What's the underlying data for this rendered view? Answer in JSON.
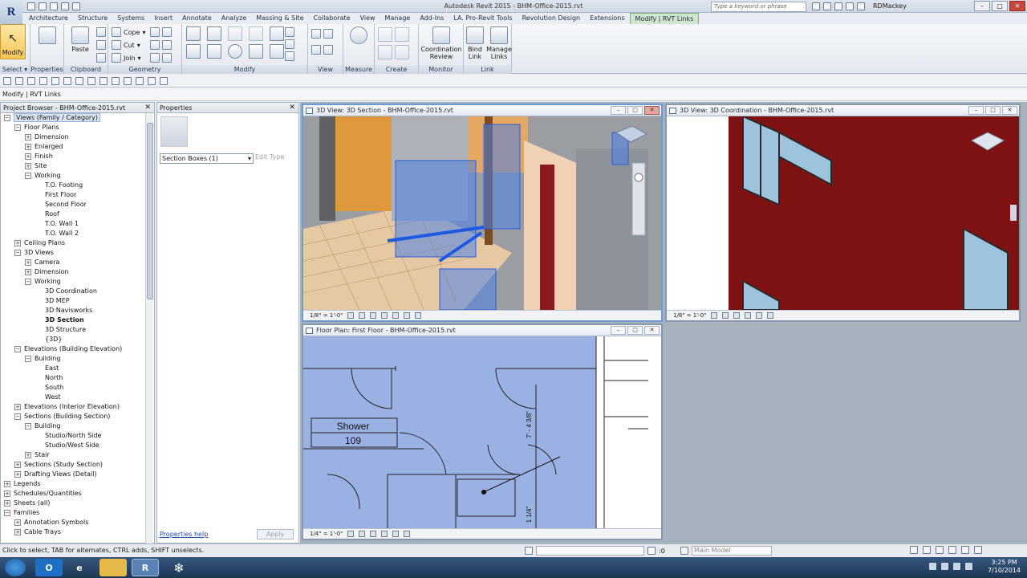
{
  "app": {
    "title": "Autodesk Revit 2015 -    BHM-Office-2015.rvt",
    "search_placeholder": "Type a keyword or phrase",
    "user": "RDMackey"
  },
  "tabs": [
    "Architecture",
    "Structure",
    "Systems",
    "Insert",
    "Annotate",
    "Analyze",
    "Massing & Site",
    "Collaborate",
    "View",
    "Manage",
    "Add-Ins",
    "LA. Pro-Revit Tools",
    "Revolution Design",
    "Extensions",
    "Modify | RVT Links"
  ],
  "ribbon": {
    "modify_label": "Modify",
    "select_label": "Select",
    "properties_label": "Properties",
    "clipboard": {
      "paste": "Paste",
      "label": "Clipboard"
    },
    "geometry": {
      "cope": "Cope",
      "cut": "Cut",
      "join": "Join",
      "label": "Geometry"
    },
    "modify_panel_label": "Modify",
    "view_label": "View",
    "measure_label": "Measure",
    "create_label": "Create",
    "coordination_review": "Coordination Review",
    "monitor_label": "Monitor",
    "bind_link": "Bind Link",
    "manage_links": "Manage Links",
    "link_label": "Link"
  },
  "option_bar": "Modify | RVT Links",
  "project_browser": {
    "title": "Project Browser - BHM-Office-2015.rvt",
    "items": [
      {
        "label": "Views (Family / Category)",
        "level": 0,
        "exp": "−",
        "hl": true
      },
      {
        "label": "Floor Plans",
        "level": 1,
        "exp": "−"
      },
      {
        "label": "Dimension",
        "level": 2,
        "exp": "+"
      },
      {
        "label": "Enlarged",
        "level": 2,
        "exp": "+"
      },
      {
        "label": "Finish",
        "level": 2,
        "exp": "+"
      },
      {
        "label": "Site",
        "level": 2,
        "exp": "+"
      },
      {
        "label": "Working",
        "level": 2,
        "exp": "−"
      },
      {
        "label": "T.O. Footing",
        "level": 3
      },
      {
        "label": "First Floor",
        "level": 3
      },
      {
        "label": "Second Floor",
        "level": 3
      },
      {
        "label": "Roof",
        "level": 3
      },
      {
        "label": "T.O. Wall 1",
        "level": 3
      },
      {
        "label": "T.O. Wall 2",
        "level": 3
      },
      {
        "label": "Ceiling Plans",
        "level": 1,
        "exp": "+"
      },
      {
        "label": "3D Views",
        "level": 1,
        "exp": "−"
      },
      {
        "label": "Camera",
        "level": 2,
        "exp": "+"
      },
      {
        "label": "Dimension",
        "level": 2,
        "exp": "+"
      },
      {
        "label": "Working",
        "level": 2,
        "exp": "−"
      },
      {
        "label": "3D Coordination",
        "level": 3
      },
      {
        "label": "3D MEP",
        "level": 3
      },
      {
        "label": "3D Navisworks",
        "level": 3
      },
      {
        "label": "3D Section",
        "level": 3,
        "bold": true
      },
      {
        "label": "3D Structure",
        "level": 3
      },
      {
        "label": "{3D}",
        "level": 3
      },
      {
        "label": "Elevations (Building Elevation)",
        "level": 1,
        "exp": "−"
      },
      {
        "label": "Building",
        "level": 2,
        "exp": "−"
      },
      {
        "label": "East",
        "level": 3
      },
      {
        "label": "North",
        "level": 3
      },
      {
        "label": "South",
        "level": 3
      },
      {
        "label": "West",
        "level": 3
      },
      {
        "label": "Elevations (Interior Elevation)",
        "level": 1,
        "exp": "+"
      },
      {
        "label": "Sections (Building Section)",
        "level": 1,
        "exp": "−"
      },
      {
        "label": "Building",
        "level": 2,
        "exp": "−"
      },
      {
        "label": "Studio/North Side",
        "level": 3
      },
      {
        "label": "Studio/West Side",
        "level": 3
      },
      {
        "label": "Stair",
        "level": 2,
        "exp": "+"
      },
      {
        "label": "Sections (Study Section)",
        "level": 1,
        "exp": "+"
      },
      {
        "label": "Drafting Views (Detail)",
        "level": 1,
        "exp": "+"
      },
      {
        "label": "Legends",
        "level": 0,
        "exp": "+"
      },
      {
        "label": "Schedules/Quantities",
        "level": 0,
        "exp": "+"
      },
      {
        "label": "Sheets (all)",
        "level": 0,
        "exp": "+"
      },
      {
        "label": "Families",
        "level": 0,
        "exp": "−"
      },
      {
        "label": "Annotation Symbols",
        "level": 1,
        "exp": "+"
      },
      {
        "label": "Cable Trays",
        "level": 1,
        "exp": "+"
      }
    ]
  },
  "properties": {
    "title": "Properties",
    "type_selector": "Section Boxes (1)",
    "edit_type": "Edit Type",
    "help": "Properties help",
    "apply": "Apply"
  },
  "views": {
    "section3d": {
      "title": "3D View: 3D Section - BHM-Office-2015.rvt",
      "scale": "1/8\" = 1'-0\""
    },
    "coord3d": {
      "title": "3D View: 3D Coordination - BHM-Office-2015.rvt",
      "scale": "1/8\" = 1'-0\""
    },
    "floorplan": {
      "title": "Floor Plan: First Floor - BHM-Office-2015.rvt",
      "scale": "1/4\" = 1'-0\"",
      "room_name": "Shower",
      "room_number": "109",
      "dim1": "7' - 4 3/8\"",
      "dim2": "1 1/4\""
    }
  },
  "status": {
    "text": "Click to select, TAB for alternates, CTRL adds, SHIFT unselects.",
    "count": ":0",
    "model": "Main Model"
  },
  "clock": {
    "time": "3:25 PM",
    "date": "7/10/2014"
  }
}
